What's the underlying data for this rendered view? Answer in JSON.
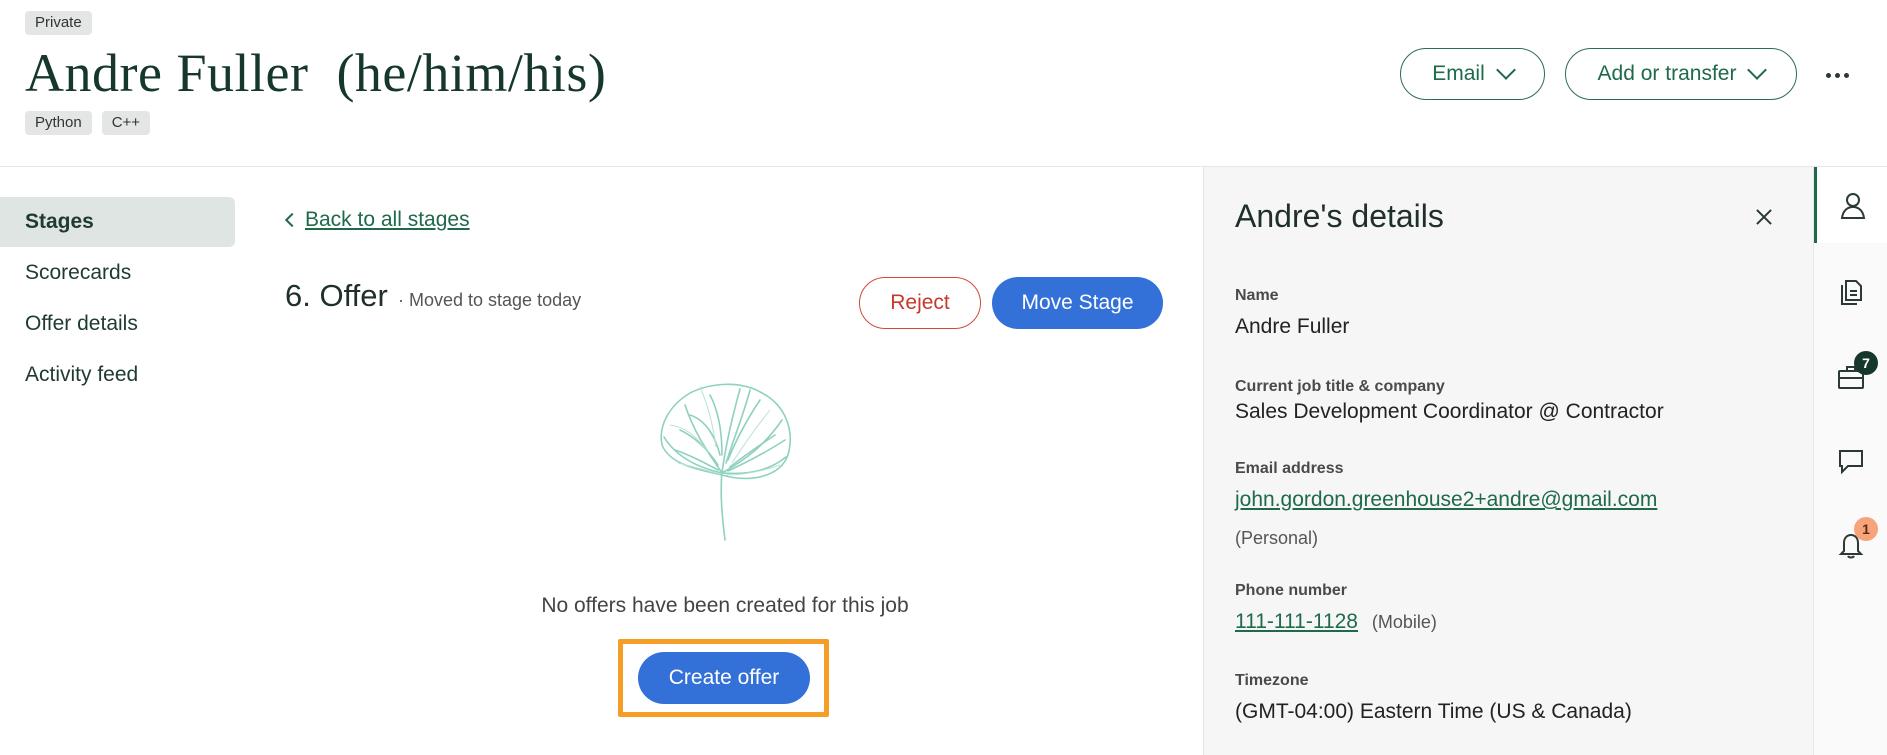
{
  "header": {
    "visibility_label": "Private",
    "candidate_name": "Andre Fuller",
    "pronouns": "(he/him/his)",
    "tags": [
      "Python",
      "C++"
    ],
    "email_button": "Email",
    "transfer_button": "Add or transfer"
  },
  "nav": {
    "items": [
      {
        "label": "Stages",
        "active": true
      },
      {
        "label": "Scorecards",
        "active": false
      },
      {
        "label": "Offer details",
        "active": false
      },
      {
        "label": "Activity feed",
        "active": false
      }
    ]
  },
  "main": {
    "back_link": "Back to all stages",
    "stage_title": "6. Offer",
    "stage_subtitle": "· Moved to stage today",
    "reject_button": "Reject",
    "move_button": "Move Stage",
    "empty_message": "No offers have been created for this job",
    "create_offer_button": "Create offer",
    "highlight_color": "#f59e27"
  },
  "details": {
    "title": "Andre's details",
    "name_label": "Name",
    "name_value": "Andre Fuller",
    "job_label": "Current job title & company",
    "job_value": "Sales Development Coordinator @ Contractor",
    "email_label": "Email address",
    "email_value": "john.gordon.greenhouse2+andre@gmail.com",
    "email_type": "(Personal)",
    "phone_label": "Phone number",
    "phone_value": "111-111-1128",
    "phone_type": "(Mobile)",
    "timezone_label": "Timezone",
    "timezone_value": "(GMT-04:00) Eastern Time (US & Canada)"
  },
  "rail": {
    "icons": [
      "person-icon",
      "documents-icon",
      "briefcase-icon",
      "chat-icon",
      "bell-icon"
    ],
    "briefcase_badge": "7",
    "bell_badge": "1"
  },
  "colors": {
    "brand_green": "#1e6a4a",
    "primary_blue": "#3371d8",
    "reject_red": "#c43b2c"
  }
}
